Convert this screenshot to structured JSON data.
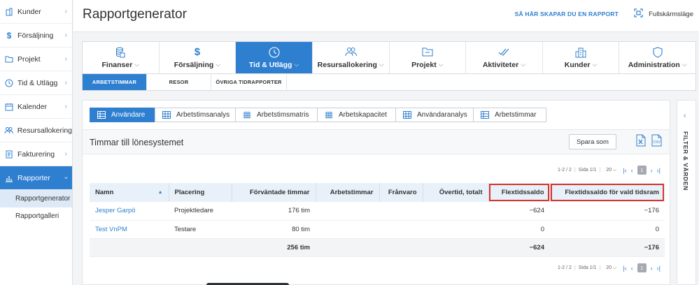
{
  "sidebar": {
    "items": [
      {
        "label": "Kunder",
        "icon": "building-icon"
      },
      {
        "label": "Försäljning",
        "icon": "dollar-icon"
      },
      {
        "label": "Projekt",
        "icon": "folder-icon"
      },
      {
        "label": "Tid & Utlägg",
        "icon": "clock-icon"
      },
      {
        "label": "Kalender",
        "icon": "calendar-icon"
      },
      {
        "label": "Resursallokering",
        "icon": "users-icon"
      },
      {
        "label": "Fakturering",
        "icon": "invoice-icon"
      },
      {
        "label": "Rapporter",
        "icon": "chart-icon"
      }
    ],
    "sub_items": [
      "Rapportgenerator",
      "Rapportgalleri"
    ]
  },
  "header": {
    "title": "Rapportgenerator",
    "how_link": "SÅ HÄR SKAPAR DU EN RAPPORT",
    "fullscreen": "Fullskärmsläge"
  },
  "categories": [
    "Finanser",
    "Försäljning",
    "Tid & Utlägg",
    "Resursallokering",
    "Projekt",
    "Aktiviteter",
    "Kunder",
    "Administration"
  ],
  "subtabs": [
    "ARBETSTIMMAR",
    "RESOR",
    "ÖVRIGA TIDRAPPORTER"
  ],
  "report_tabs": [
    "Användare",
    "Arbetstimsanalys",
    "Arbetstimsmatris",
    "Arbetskapacitet",
    "Användaranalys",
    "Arbetstimmar"
  ],
  "report": {
    "title": "Timmar till lönesystemet",
    "save_label": "Spara som",
    "csv_label": "CSV"
  },
  "pager": {
    "range": "1-2 / 2",
    "page_info": "Sida 1/1",
    "page_size": "20",
    "current": "1"
  },
  "table": {
    "columns": [
      "Namn",
      "Placering",
      "Förväntade timmar",
      "Arbetstimmar",
      "Frånvaro",
      "Övertid, totalt",
      "Flextidssaldo",
      "Flextidssaldo för vald tidsram"
    ],
    "rows": [
      {
        "name": "Jesper Garpö",
        "placement": "Projektledare",
        "expected": "176 tim",
        "worked": "",
        "absence": "",
        "overtime": "",
        "flex": "−624",
        "flex_range": "−176"
      },
      {
        "name": "Test VnPM",
        "placement": "Testare",
        "expected": "80 tim",
        "worked": "",
        "absence": "",
        "overtime": "",
        "flex": "0",
        "flex_range": "0"
      }
    ],
    "total": {
      "expected": "256 tim",
      "flex": "−624",
      "flex_range": "−176"
    }
  },
  "filter": {
    "label": "FILTER & VÄRDEN"
  }
}
